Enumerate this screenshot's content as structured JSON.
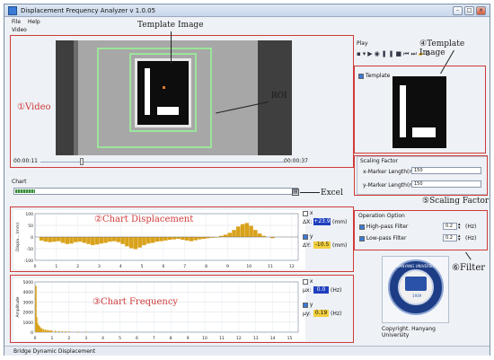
{
  "window": {
    "title": "Displacement Frequency Analyzer   v 1.0.05"
  },
  "menu": {
    "file": "File",
    "help": "Help"
  },
  "sections": {
    "video": "Video",
    "chart": "Chart",
    "play": "Play"
  },
  "video": {
    "time_start": "00:00:11",
    "time_end": "00:00:37"
  },
  "callouts": {
    "template_image": "Template Image",
    "roi": "ROI",
    "video": "①Video",
    "chart_displacement": "②Chart  Displacement",
    "chart_frequency": "③Chart  Frequency",
    "template_image_panel": "④Template Image",
    "scaling_factor": "⑤Scaling Factor",
    "filter": "⑥Filter",
    "excel": "Excel"
  },
  "template_panel": {
    "checkbox_label": "Template"
  },
  "scaling": {
    "group_title": "Scaling Factor",
    "x_label": "x-Marker Length(mm)",
    "x_value": "150",
    "y_label": "y-Marker Length(mm)",
    "y_value": "150"
  },
  "operation": {
    "group_title": "Operation Option",
    "hp_label": "High-pass Filter",
    "hp_value": "0.2",
    "lp_label": "Low-pass Filter",
    "lp_value": "0.2",
    "unit": "(Hz)"
  },
  "logo": {
    "university": "HANYANG UNIVERSITY",
    "year": "1939",
    "copyright": "Copyright. Hanyang University"
  },
  "disp_panel": {
    "x_label": "x",
    "dx_label": "ΔX:",
    "dx_value": "+23.9",
    "dx_unit": "(mm)",
    "y_label": "y",
    "dy_label": "ΔY:",
    "dy_value": "-10.5",
    "dy_unit": "(mm)"
  },
  "freq_panel": {
    "x_label": "x",
    "fx_label": "μx:",
    "fx_value": "0.0",
    "fx_unit": "(Hz)",
    "y_label": "y",
    "fy_label": "μy:",
    "fy_value": "0.19",
    "fy_unit": "(Hz)"
  },
  "status": {
    "text": "Bridge Dynamic Displacement"
  },
  "colors": {
    "accent_red": "#d03a3a",
    "bar_yellow": "#d9a21b",
    "value_blue": "#1f3fbf",
    "value_yellow": "#f3cf3f"
  },
  "chart_data": [
    {
      "type": "bar",
      "title": "",
      "ylabel": "Displa... (mm)",
      "ylim": [
        -100,
        100
      ],
      "yticks": [
        "100",
        "50",
        "0",
        "-50",
        "-100"
      ],
      "xticks": [
        "0",
        "1",
        "2",
        "3",
        "4",
        "5",
        "6",
        "7",
        "8",
        "9",
        "10",
        "11",
        "12"
      ],
      "x": [
        0.3,
        0.5,
        0.7,
        0.9,
        1.1,
        1.3,
        1.5,
        1.7,
        1.9,
        2.1,
        2.3,
        2.5,
        2.7,
        2.9,
        3.1,
        3.3,
        3.5,
        3.7,
        3.9,
        4.1,
        4.3,
        4.5,
        4.7,
        4.9,
        5.1,
        5.3,
        5.5,
        5.7,
        5.9,
        6.1,
        6.3,
        6.5,
        6.7,
        6.9,
        7.1,
        7.3,
        7.5,
        7.7,
        7.9,
        8.1,
        8.3,
        8.5,
        8.7,
        8.9,
        9.1,
        9.3,
        9.5,
        9.7,
        9.9,
        10.1,
        10.3,
        10.5,
        10.7,
        10.9,
        11.1
      ],
      "values": [
        -15,
        -20,
        -22,
        -20,
        -18,
        -25,
        -30,
        -28,
        -22,
        -20,
        -25,
        -30,
        -35,
        -32,
        -28,
        -25,
        -20,
        -18,
        -22,
        -30,
        -40,
        -48,
        -52,
        -45,
        -35,
        -28,
        -25,
        -20,
        -18,
        -15,
        -12,
        -10,
        -8,
        -12,
        -15,
        -18,
        -14,
        -10,
        -8,
        -5,
        -3,
        -2,
        5,
        10,
        18,
        30,
        45,
        55,
        60,
        48,
        30,
        15,
        5,
        0,
        -5
      ]
    },
    {
      "type": "bar",
      "title": "",
      "ylabel": "Amplitude",
      "ylim": [
        0,
        5000
      ],
      "yticks": [
        "5000",
        "4000",
        "3000",
        "2000",
        "1000",
        "0"
      ],
      "xticks": [
        "0",
        "1",
        "2",
        "3",
        "4",
        "5",
        "6",
        "7",
        "8",
        "9",
        "10",
        "11",
        "12",
        "13",
        "14",
        "15"
      ],
      "x": [
        0.05,
        0.1,
        0.15,
        0.2,
        0.25,
        0.3,
        0.35,
        0.4,
        0.5,
        0.6,
        0.7,
        0.8,
        0.9,
        1.0,
        1.2,
        1.4,
        1.6,
        1.8,
        2.0,
        2.5,
        3.0
      ],
      "values": [
        4600,
        1500,
        900,
        700,
        600,
        500,
        400,
        350,
        300,
        250,
        220,
        200,
        180,
        160,
        140,
        120,
        100,
        90,
        80,
        60,
        50
      ]
    }
  ]
}
